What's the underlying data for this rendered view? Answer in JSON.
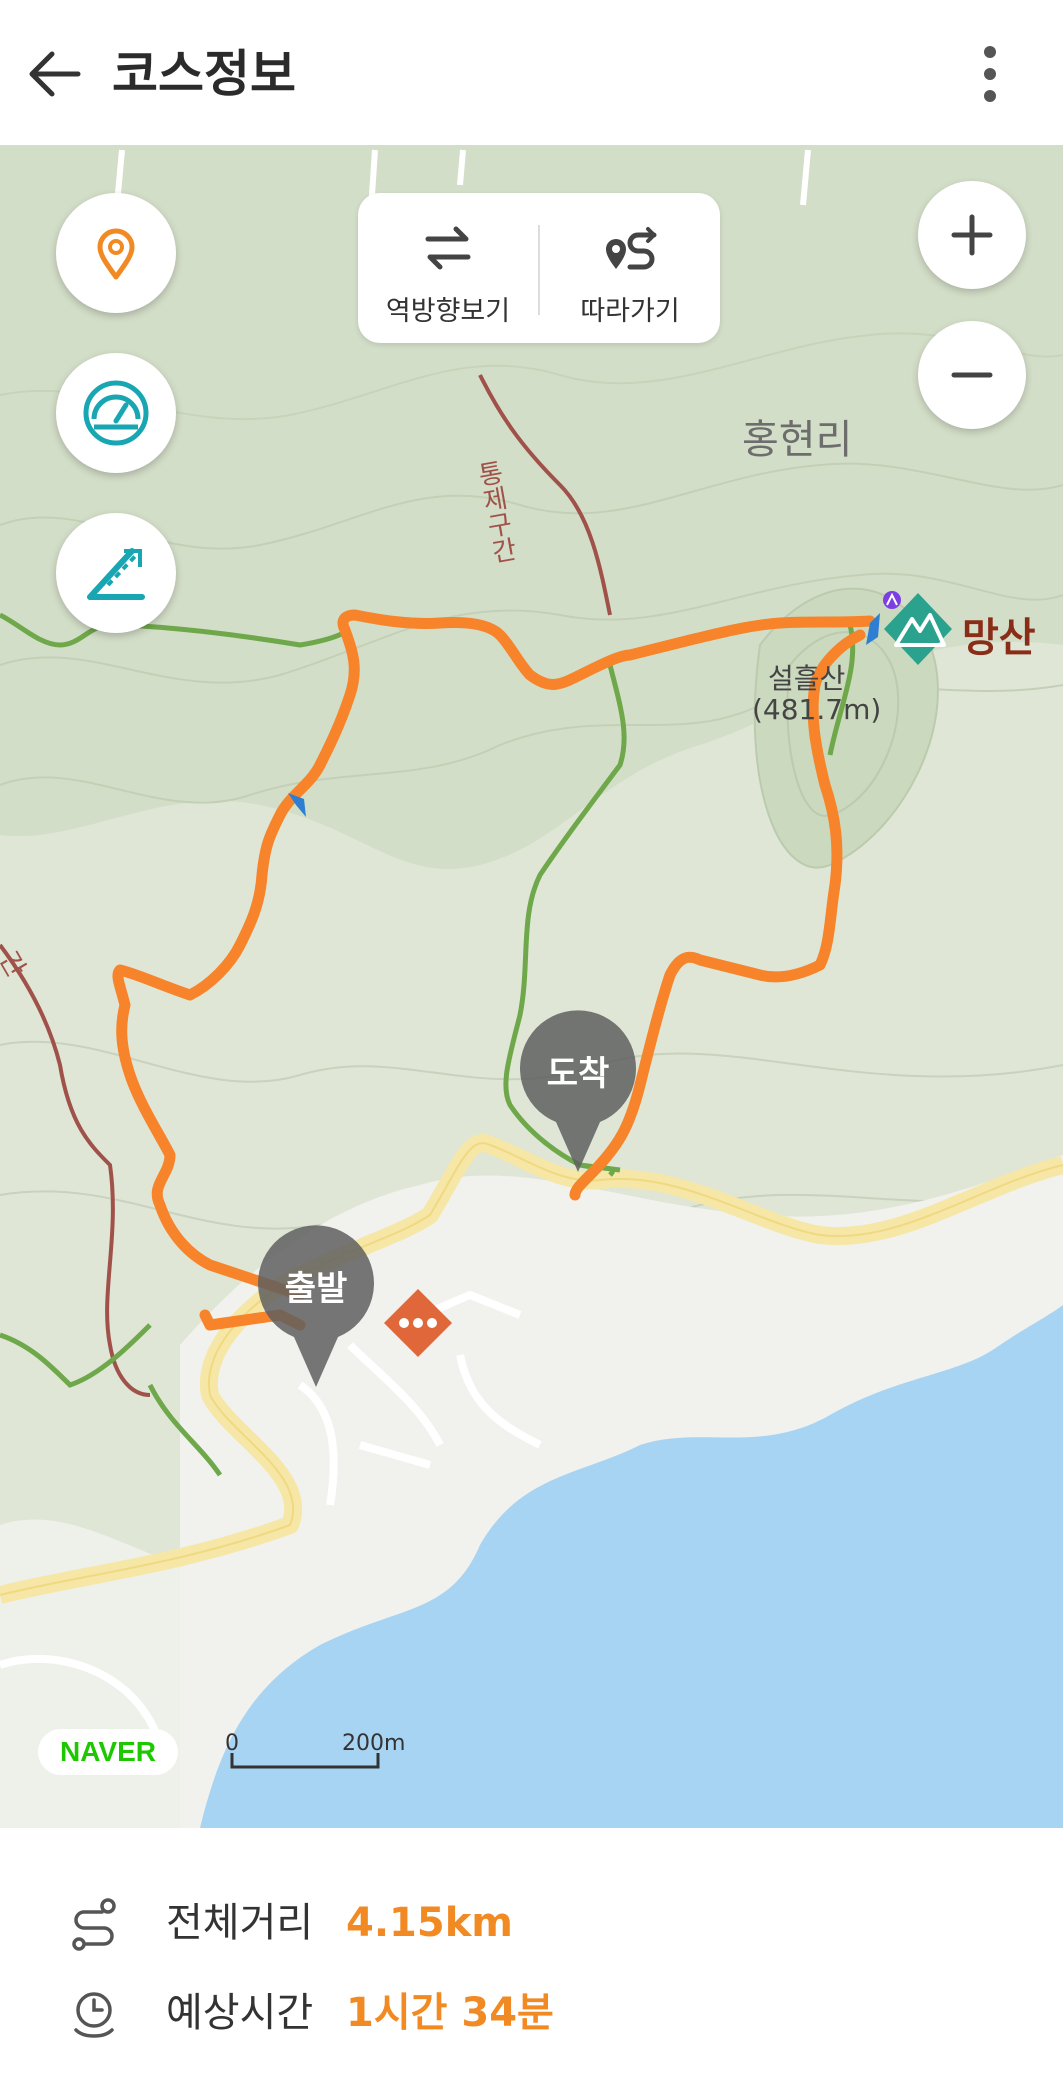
{
  "header": {
    "title": "코스정보",
    "back_icon": "arrow-left-icon",
    "menu_icon": "more-vertical-icon"
  },
  "map": {
    "toolbar": {
      "reverse_label": "역방향보기",
      "follow_label": "따라가기"
    },
    "labels": {
      "village": "홍현리",
      "restricted_section": "통제구간",
      "restricted_section_left": "간",
      "peak_name": "설흘산",
      "peak_height": "(481.7m)",
      "mountain": "망산",
      "start": "출발",
      "arrival": "도착",
      "logo": "NAVER",
      "scale_zero": "0",
      "scale_max": "200m"
    },
    "colors": {
      "route": "#f7832a",
      "trail": "#6fa84a",
      "restricted": "#a0524a",
      "road": "#f6e7a6",
      "sea": "#a7d4f2",
      "accent": "#f28a24"
    }
  },
  "info": {
    "distance_label": "전체거리",
    "distance_value": "4.15km",
    "time_label": "예상시간",
    "time_value": "1시간 34분"
  }
}
